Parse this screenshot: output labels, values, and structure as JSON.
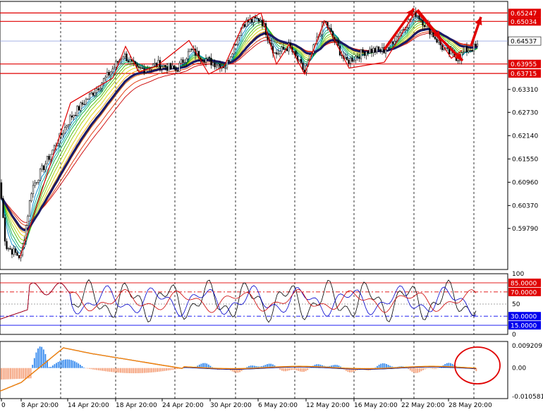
{
  "chart_data": [
    {
      "type": "candlestick",
      "ylim": [
        0.5875,
        0.6554
      ],
      "ytick_labels": [
        "0.63310",
        "0.62730",
        "0.62140",
        "0.61550",
        "0.60960",
        "0.60370",
        "0.59790"
      ],
      "ytick_values": [
        0.6331,
        0.6273,
        0.6214,
        0.6155,
        0.6096,
        0.6037,
        0.5979
      ],
      "xtick_labels": [
        "0",
        "8 Apr 20:00",
        "14 Apr 20:00",
        "18 Apr 20:00",
        "24 Apr 20:00",
        "30 Apr 20:00",
        "6 May 20:00",
        "12 May 20:00",
        "16 May 20:00",
        "22 May 20:00",
        "28 May 20:00"
      ],
      "price_label": "0.64537",
      "price_value": 0.64537,
      "horizontal_levels": [
        {
          "label": "0.65247",
          "value": 0.65247,
          "color": "#e00000"
        },
        {
          "label": "0.65034",
          "value": 0.65034,
          "color": "#e00000"
        },
        {
          "label": "0.63955",
          "value": 0.63955,
          "color": "#e00000"
        },
        {
          "label": "0.63715",
          "value": 0.63715,
          "color": "#e00000"
        }
      ],
      "zigzag_color": "#e00000",
      "main_ma_color": "#1a1a66",
      "arrow_color": "#e00000"
    },
    {
      "type": "line",
      "ylim": [
        0,
        100
      ],
      "ytick_labels": [
        "100",
        "50",
        "0"
      ],
      "ytick_values": [
        100,
        50,
        0
      ],
      "levels": [
        {
          "label": "85.0000",
          "value": 85,
          "color": "#e00000"
        },
        {
          "label": "70.0000",
          "value": 70,
          "color": "#e00000"
        },
        {
          "label": "30.0000",
          "value": 30,
          "color": "#0000ee"
        },
        {
          "label": "15.0000",
          "value": 15,
          "color": "#0000ee"
        }
      ],
      "series_colors": [
        "#000000",
        "#0000cc",
        "#cc0000"
      ]
    },
    {
      "type": "bar",
      "ylim": [
        -0.010581,
        0.0092097
      ],
      "ytick_labels": [
        "0.0092097",
        "0.00",
        "-0.010581"
      ],
      "ytick_values": [
        0.0092097,
        0,
        -0.010581
      ],
      "positive_color": "#3388ee",
      "negative_color": "#f4a07a",
      "signal_colors": [
        "#1a1a88",
        "#ff8800"
      ]
    }
  ]
}
